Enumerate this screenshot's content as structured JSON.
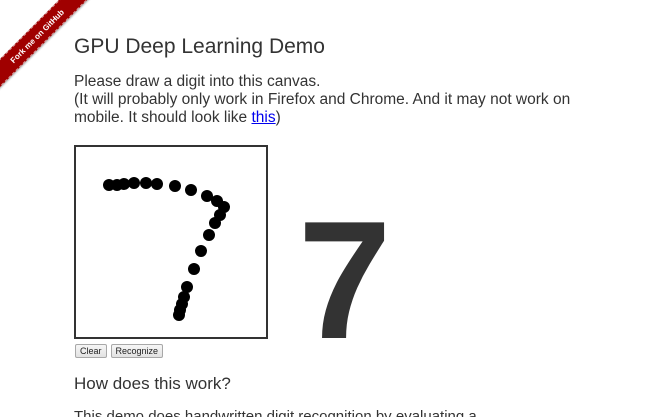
{
  "ribbon": {
    "label": "Fork me on GitHub",
    "color": "#a00000"
  },
  "title": "GPU Deep Learning Demo",
  "intro": {
    "line1": "Please draw a digit into this canvas.",
    "line2_before": "(It will probably only work in Firefox and Chrome. And it may not work on mobile. It should look like ",
    "link": "this",
    "line2_after": ")"
  },
  "buttons": {
    "clear": "Clear",
    "recognize": "Recognize"
  },
  "prediction": "7",
  "section": {
    "heading": "How does this work?",
    "text": "This demo does handwritten digit recognition by evaluating a"
  }
}
